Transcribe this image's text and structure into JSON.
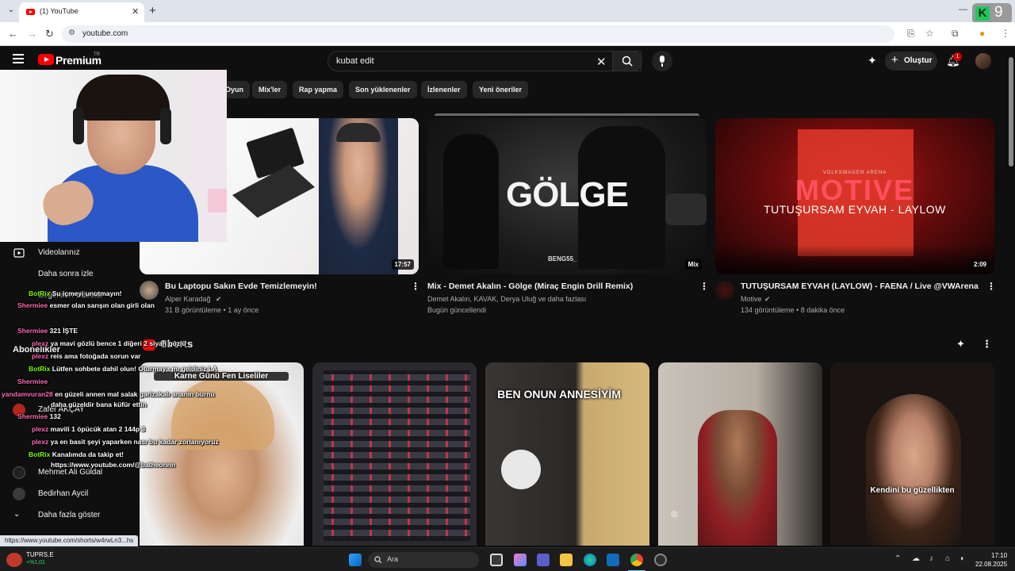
{
  "browser": {
    "tab_title": "(1) YouTube",
    "url": "youtube.com",
    "extension_badge_number": "9"
  },
  "header": {
    "logo_text": "Premium",
    "logo_region": "TR",
    "search_value": "kubat edit",
    "create_label": "Oluştur",
    "notification_count": "1"
  },
  "chips": [
    "Oyun",
    "Mix'ler",
    "Rap yapma",
    "Son yüklenenler",
    "İzlenenler",
    "Yeni öneriler"
  ],
  "sidebar": {
    "items": [
      {
        "label": "Videolarınız",
        "icon": "play-square-icon"
      },
      {
        "label": "Daha sonra izle",
        "icon": "clock-icon"
      },
      {
        "label": "Beğenilen videolar",
        "icon": "thumbs-up-icon"
      }
    ],
    "subscriptions_heading": "Abonelikler",
    "subscriptions": [
      {
        "label": "Zafer AKÇAY"
      },
      {
        "label": "Mehmet Ali Güldal"
      },
      {
        "label": "Bedirhan Aycil"
      }
    ],
    "show_more": "Daha fazla göster"
  },
  "videos": [
    {
      "title": "Bu Laptopu Sakın Evde Temizlemeyin!",
      "channel": "Alper Karadağ",
      "meta": "31 B görüntüleme • 1 ay önce",
      "duration": "17:57"
    },
    {
      "title": "Mix - Demet Akalın - Gölge (Miraç Engin Drill Remix)",
      "channel": "Demet Akalın, KAVAK, Derya Uluğ ve daha fazlası",
      "meta": "Bugün güncellendi",
      "duration": "Mix",
      "thumb_text": "GÖLGE",
      "watermark": "BENG55_"
    },
    {
      "title": "TUTUŞURSAM EYVAH (LAYLOW) - FAENA / Live @VWArena",
      "channel": "Motive",
      "meta": "134 görüntüleme • 8 dakika önce",
      "duration": "2:09",
      "thumb_big": "MOTIVE",
      "thumb_sub": "TUTUŞURSAM EYVAH - LAYLOW",
      "thumb_small": "VOLKSWAGEN ARENA"
    }
  ],
  "shorts": {
    "label": "Shorts",
    "items": [
      {
        "caption": "Karne Günü Fen Liseliler"
      },
      {
        "caption": ""
      },
      {
        "caption": "BEN ONUN ANNESİYİM"
      },
      {
        "caption": ""
      },
      {
        "caption": "Kendini bu güzellikten"
      }
    ]
  },
  "chat": [
    {
      "user": "BotRix",
      "text": "Su içmeyi unutmayın!",
      "color": "#7cfc00"
    },
    {
      "user": "Shermiee",
      "text": "esmer olan sarışın olan girli olan",
      "color": "#ff6ab4"
    },
    {
      "user": "Shermiee",
      "text": "321 İŞTE",
      "color": "#ff6ab4"
    },
    {
      "user": "plexz",
      "text": "ya mavi gözlü bence 1 diğeri 2 siyah gözlü",
      "color": "#ff6ab4"
    },
    {
      "user": "plexz",
      "text": "reis ama fotoğada sorun var",
      "color": "#ff6ab4"
    },
    {
      "user": "BotRix",
      "text": "Lütfen sohbete dahil olun! Oturmaya mı geldiniz LA",
      "color": "#7cfc00"
    },
    {
      "user": "Shermiee",
      "text": "",
      "color": "#ff6ab4"
    },
    {
      "user": "yandamvuran28",
      "text": "en güzeli annen mal salak garizakalı ananın burnu",
      "color": "#ff6ab4"
    },
    {
      "user": "",
      "text": "daha güzeldir bana küfür ettin",
      "color": "#ff6ab4"
    },
    {
      "user": "Shermiee",
      "text": "132",
      "color": "#ff6ab4"
    },
    {
      "user": "plexz",
      "text": "mavili 1 öpücük atan 2 144p 3",
      "color": "#ff6ab4"
    },
    {
      "user": "plexz",
      "text": "ya en basit şeyi yaparken nası bu kadar zorlanıyoruz",
      "color": "#ff6ab4"
    },
    {
      "user": "BotRix",
      "text": "Kanalımda da takip et!",
      "color": "#7cfc00"
    },
    {
      "user": "",
      "text": "https://www.youtube.com/@batheonnn",
      "color": "#7cfc00"
    }
  ],
  "status_url": "https://www.youtube.com/shorts/w4rwLn3...hs",
  "taskbar": {
    "weather_ticker": "TUPRS.E",
    "weather_change": "+%1,01",
    "search_label": "Ara",
    "time": "17:10",
    "date": "22.08.2025"
  },
  "colors": {
    "yt_red": "#ff0000",
    "background": "#0f0f0f",
    "chip_bg": "#272727",
    "meta_text": "#aaaaaa"
  }
}
